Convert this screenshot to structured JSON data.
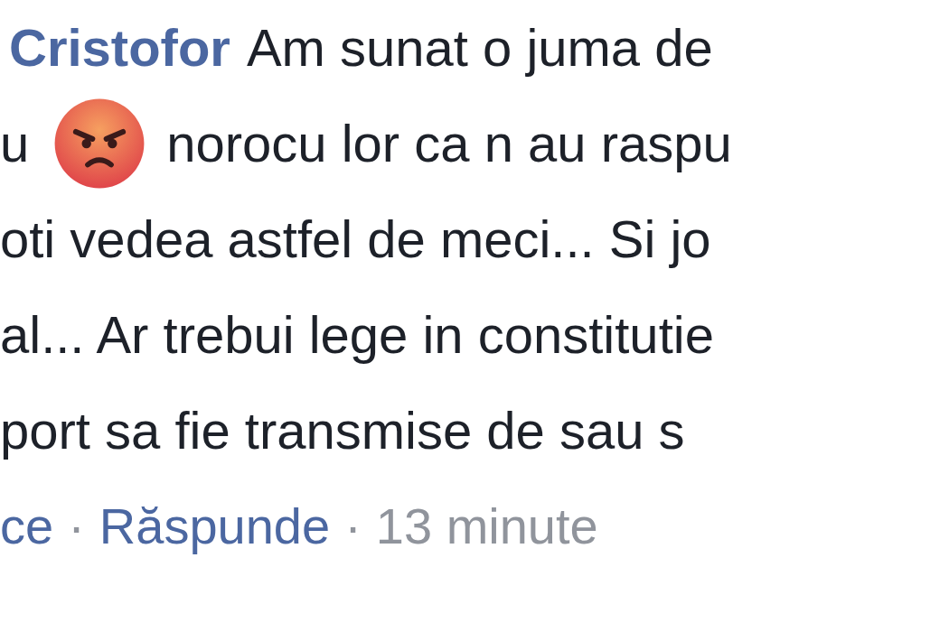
{
  "comment": {
    "author": "Cristofor",
    "lines": [
      {
        "kind": "author_line",
        "text": "Am sunat o juma de"
      },
      {
        "kind": "emoji_line",
        "before": "u",
        "after": "norocu lor ca n au raspu"
      },
      {
        "kind": "text",
        "text": "oti vedea astfel de meci... Si jo"
      },
      {
        "kind": "text",
        "text": "al... Ar trebui lege in constitutie"
      },
      {
        "kind": "text",
        "text": "port sa fie transmise de sau s"
      }
    ],
    "actions": [
      {
        "kind": "link",
        "label": "ce"
      },
      {
        "kind": "link",
        "separator": "·",
        "label": "Răspunde"
      },
      {
        "kind": "time",
        "separator": "·",
        "label": "13 minute"
      }
    ]
  }
}
